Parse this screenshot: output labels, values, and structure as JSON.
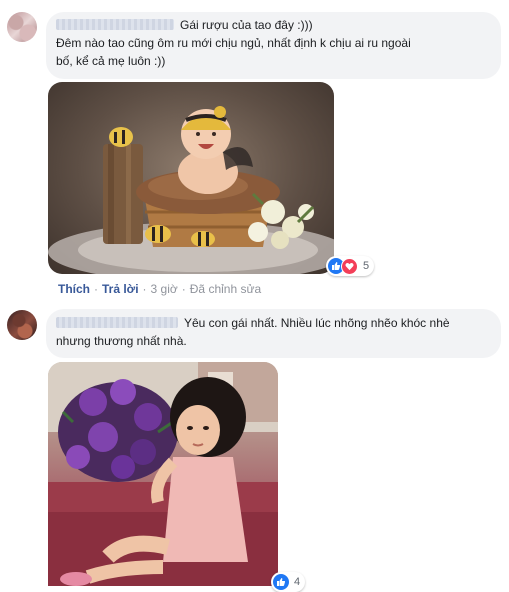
{
  "comments": [
    {
      "line1": "Gái rượu của tao đây :)))",
      "line2": "Đêm nào tao cũng ôm ru mới chịu ngủ, nhất định k chịu ai ru ngoài",
      "line3": "bố, kể cả mẹ luôn :))",
      "reactions": {
        "icons": [
          "like-icon",
          "love-icon"
        ],
        "count": "5"
      },
      "actions": {
        "like": "Thích",
        "reply": "Trả lời",
        "time": "3 giờ",
        "edited": "Đã chỉnh sửa"
      }
    },
    {
      "line1": "Yêu con gái nhất. Nhiều lúc nhõng nhẽo khóc nhè",
      "line2": "nhưng thương nhất nhà.",
      "reactions": {
        "icons": [
          "like-icon"
        ],
        "count": "4"
      }
    }
  ],
  "colors": {
    "bubble": "#f2f3f5",
    "link": "#385898",
    "meta": "#90949c",
    "like": "#2078f4",
    "love": "#f33e58"
  }
}
